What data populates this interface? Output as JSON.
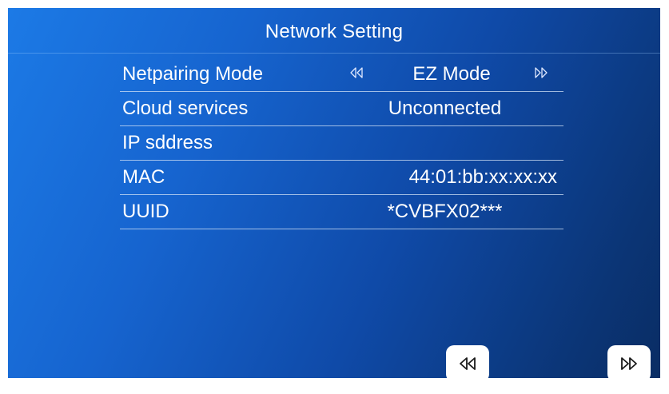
{
  "header": {
    "title": "Network Setting"
  },
  "rows": {
    "netpairing": {
      "label": "Netpairing Mode",
      "value": "EZ Mode",
      "prev_icon": "double-chevron-left-icon",
      "next_icon": "double-chevron-right-icon"
    },
    "cloud": {
      "label": "Cloud services",
      "value": "Unconnected"
    },
    "ip": {
      "label": "IP sddress",
      "value": ""
    },
    "mac": {
      "label": "MAC",
      "value": "44:01:bb:xx:xx:xx"
    },
    "uuid": {
      "label": "UUID",
      "value": "*CVBFX02***"
    }
  },
  "footer": {
    "prev_icon": "double-chevron-left-icon",
    "next_icon": "double-chevron-right-icon"
  },
  "colors": {
    "background_start": "#1c7ae6",
    "background_end": "#0a2d64",
    "text": "#ffffff",
    "divider": "#d2e1f5",
    "button_bg": "#ffffff"
  }
}
